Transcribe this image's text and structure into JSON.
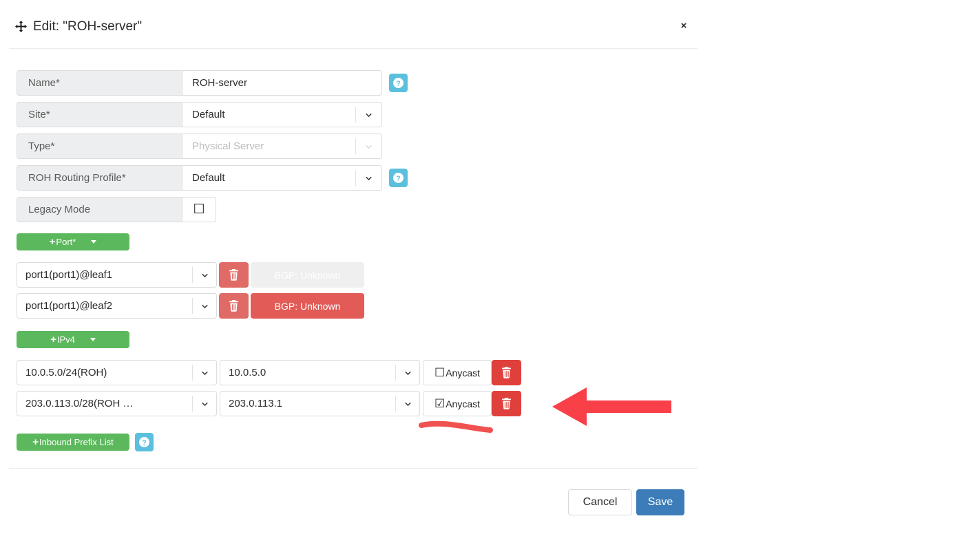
{
  "header": {
    "title": "Edit: \"ROH-server\"",
    "move_icon": "move-arrows-icon",
    "close_label": "×"
  },
  "form": {
    "rows": [
      {
        "label": "Name*",
        "value": "ROH-server",
        "type": "text",
        "help": true,
        "disabled": false
      },
      {
        "label": "Site*",
        "value": "Default",
        "type": "select",
        "help": false,
        "disabled": false
      },
      {
        "label": "Type*",
        "value": "Physical Server",
        "type": "select",
        "help": false,
        "disabled": true
      },
      {
        "label": "ROH Routing Profile*",
        "value": "Default",
        "type": "select",
        "help": true,
        "disabled": false
      },
      {
        "label": "Legacy Mode",
        "value": "☐",
        "type": "checkbox",
        "help": false,
        "disabled": false
      }
    ]
  },
  "ports": {
    "add_label": "Port*",
    "add_plus": "+",
    "rows": [
      {
        "name": "port1(port1)@leaf1",
        "status": "BGP: Unknown",
        "status_color": "#c5292a",
        "trash_color": "#e06a66"
      },
      {
        "name": "port1(port1)@leaf2",
        "status": "BGP: Unknown",
        "status_color": "#e25b56",
        "trash_color": "#e06a66"
      }
    ]
  },
  "ipv4": {
    "add_label": "IPv4",
    "add_plus": "+",
    "rows": [
      {
        "prefix": "10.0.5.0/24(ROH)",
        "address": "10.0.5.0",
        "anycast_label": "Anycast",
        "anycast_checked": false,
        "anycast_box": "☐",
        "trash_color": "#e0403c"
      },
      {
        "prefix": "203.0.113.0/28(ROH …",
        "address": "203.0.113.1",
        "anycast_label": "Anycast",
        "anycast_checked": true,
        "anycast_box": "☑",
        "trash_color": "#e0403c"
      }
    ]
  },
  "inbound": {
    "button_label": "Inbound Prefix List",
    "plus": "+",
    "help": true
  },
  "footer": {
    "cancel_label": "Cancel",
    "save_label": "Save"
  },
  "annotation": {
    "arrow_color": "#f93f48",
    "underline_color": "#f0524f"
  },
  "colors": {
    "green": "#5cb85c",
    "help_blue": "#5bc0de",
    "save_blue": "#3c7cb8",
    "label_bg": "#eceeef"
  }
}
